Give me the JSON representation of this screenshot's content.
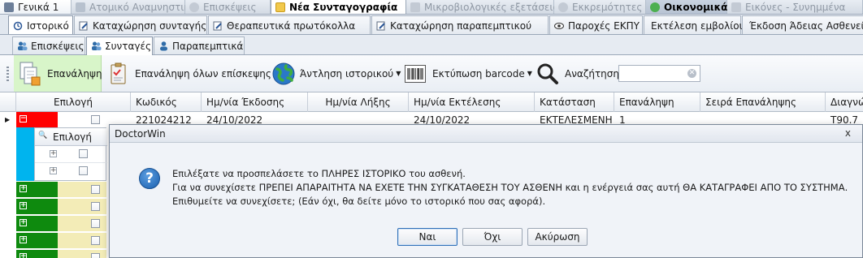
{
  "top_tabs": [
    {
      "label": "Γενικά 1",
      "icon": "folder-icon",
      "state": "on"
    },
    {
      "label": "Ατομικό Αναμνηστικό",
      "icon": "book-icon",
      "state": "dim"
    },
    {
      "label": "Επισκέψεις",
      "icon": "stethoscope-icon",
      "state": "dim"
    },
    {
      "label": "Νέα Συνταγογραφία",
      "icon": "envelope-icon",
      "state": "active"
    },
    {
      "label": "Μικροβιολογικές εξετάσεις",
      "icon": "flask-icon",
      "state": "dim"
    },
    {
      "label": "Εκκρεμότητες",
      "icon": "clock-icon",
      "state": "dim"
    },
    {
      "label": "Οικονομικά",
      "icon": "money-icon",
      "state": "econ"
    },
    {
      "label": "Εικόνες - Συνημμένα",
      "icon": "image-icon",
      "state": "dim"
    }
  ],
  "second_tabs": [
    {
      "label": "Ιστορικό",
      "icon": "history-icon"
    },
    {
      "label": "Καταχώρηση συνταγής",
      "icon": "edit-icon"
    },
    {
      "label": "Θεραπευτικά πρωτόκολλα",
      "icon": "edit-icon"
    },
    {
      "label": "Καταχώρηση παραπεμπτικού",
      "icon": "edit-icon"
    },
    {
      "label": "Παροχές ΕΚΠΥ",
      "icon": "eye-icon"
    },
    {
      "label": "Εκτέλεση εμβολίου",
      "icon": ""
    },
    {
      "label": "Έκδοση Άδειας Ασθενεία",
      "icon": ""
    }
  ],
  "third_tabs": [
    {
      "label": "Επισκέψεις",
      "icon": "users-icon"
    },
    {
      "label": "Συνταγές",
      "icon": "users-icon"
    },
    {
      "label": "Παραπεμπτικά",
      "icon": "user-icon"
    }
  ],
  "toolbar": {
    "repeat": "Επανάληψη",
    "repeat_all": "Επανάληψη όλων επίσκεψης",
    "fetch_history": "Άντληση ιστορικού",
    "print_barcode": "Εκτύπωση barcode",
    "search": "Αναζήτηση",
    "search_value": ""
  },
  "grid": {
    "columns": [
      "Επιλογή",
      "Κωδικός",
      "Ημ/νία Έκδοσης",
      "Ημ/νία Λήξης",
      "Ημ/νία Εκτέλεσης",
      "Κατάσταση",
      "Επανάληψη",
      "Σειρά Επανάληψης",
      "Διαγνώ"
    ],
    "first_row": {
      "code": "221024212",
      "issue": "24/10/2022",
      "expiry": "",
      "exec": "24/10/2022",
      "status": "ΕΚΤΕΛΕΣΜΕΝΗ",
      "repeat": "1",
      "series": "",
      "diag": "T90.7"
    },
    "detail_header": "Επιλογή",
    "colors": {
      "red": "#ff0000",
      "green": "#0e8a0e",
      "cyan": "#00b4ee",
      "yellow": "#f3ecb7"
    }
  },
  "dialog": {
    "title": "DoctorWin",
    "close_glyph": "x",
    "icon_glyph": "?",
    "lines": [
      "Επιλέξατε να προσπελάσετε το ΠΛΗΡΕΣ ΙΣΤΟΡΙΚΟ του ασθενή.",
      "Για να συνεχίσετε ΠΡΕΠΕΙ ΑΠΑΡΑΙΤΗΤΑ ΝΑ ΕΧΕΤΕ ΤΗΝ ΣΥΓΚΑΤΑΘΕΣΗ ΤΟΥ ΑΣΘΕΝΗ και η ενέργειά σας αυτή ΘΑ ΚΑΤΑΓΡΑΦΕΙ ΑΠΟ ΤΟ ΣΥΣΤΗΜΑ.",
      "Επιθυμείτε να συνεχίσετε; (Εάν όχι, θα δείτε μόνο το ιστορικό που σας αφορά)."
    ],
    "yes": "Ναι",
    "no": "Όχι",
    "cancel": "Ακύρωση"
  }
}
